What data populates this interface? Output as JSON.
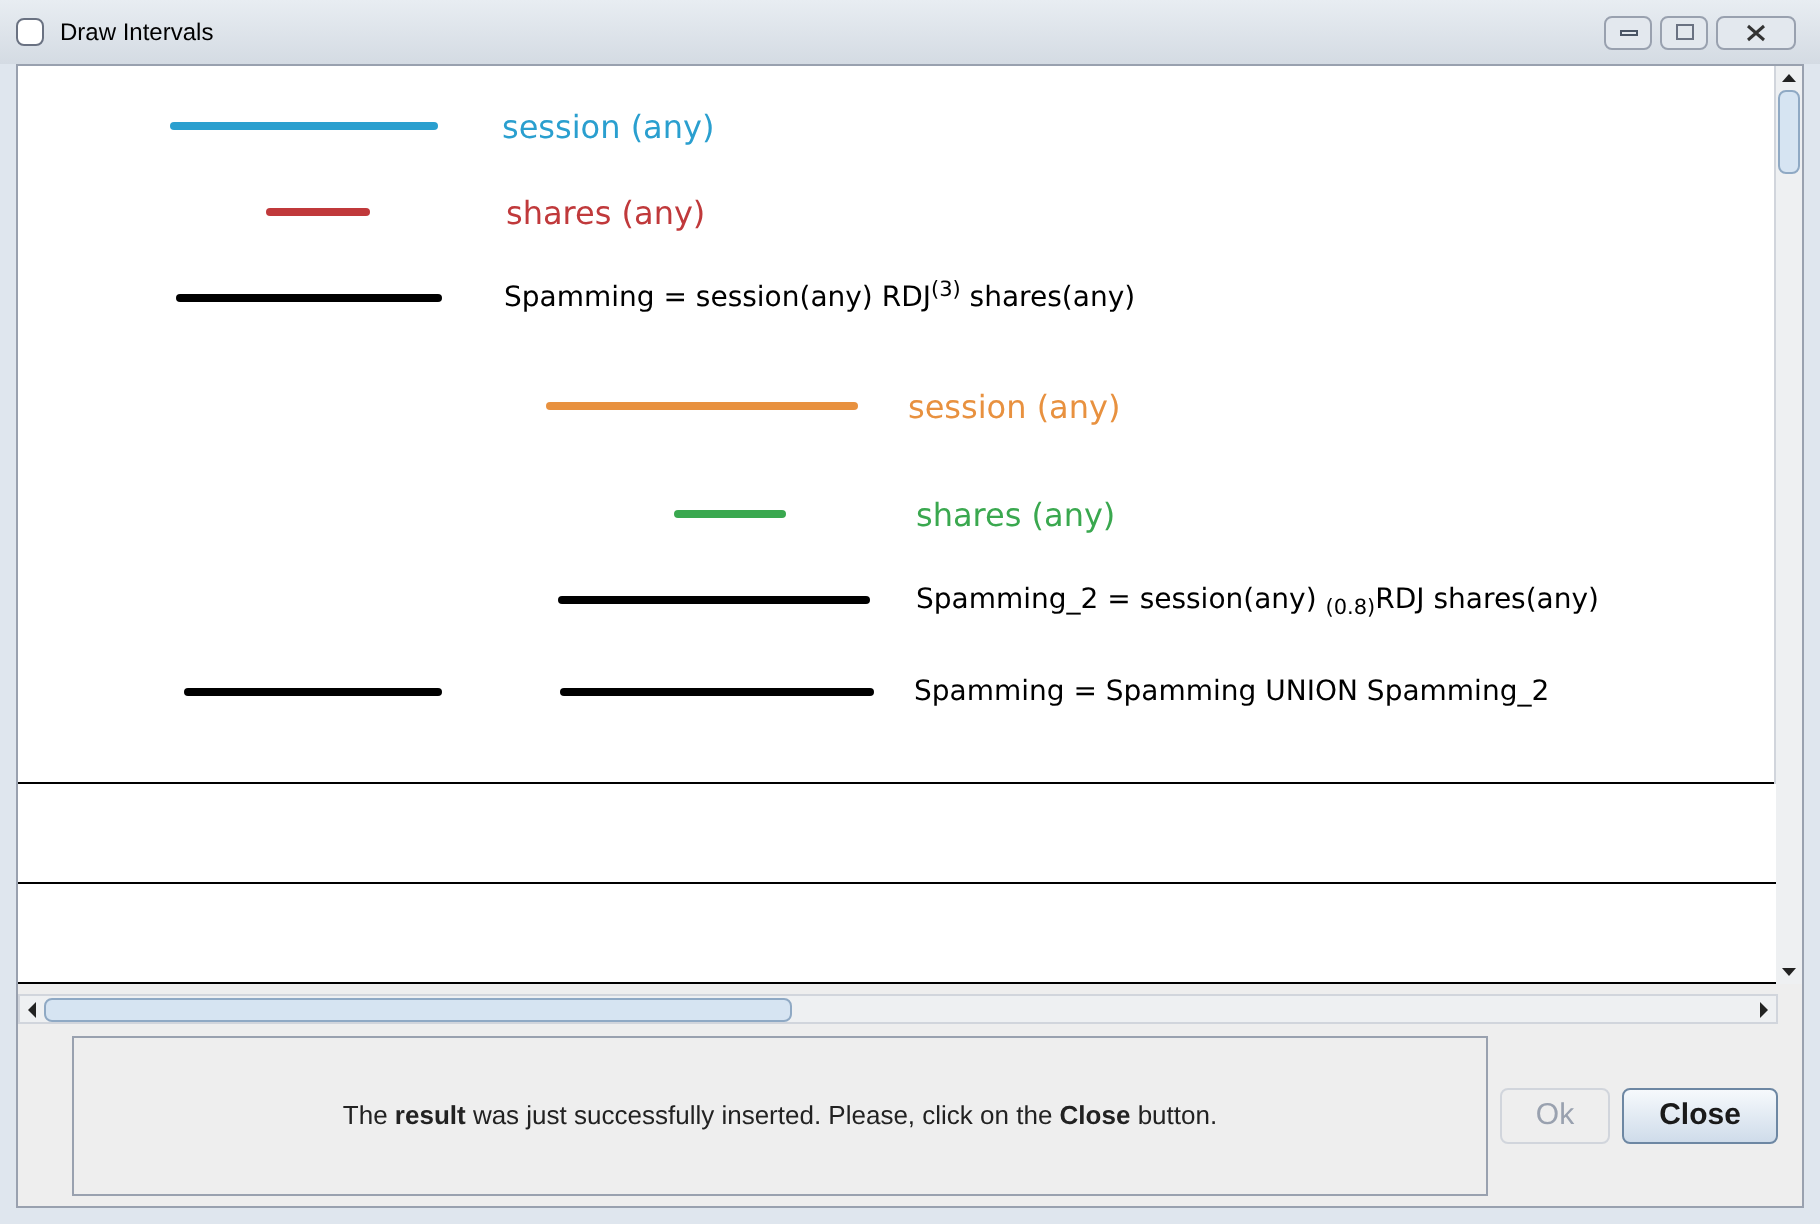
{
  "window": {
    "title": "Draw Intervals"
  },
  "intervals": [
    {
      "label": "session (any)",
      "color": "#2a9fcf",
      "kind": "operand"
    },
    {
      "label": "shares (any)",
      "color": "#c0393b",
      "kind": "operand"
    },
    {
      "label": "Spamming = session(any) RDJ$^{(3)}$ shares(any)",
      "color": "#000000",
      "kind": "result"
    },
    {
      "label": "session (any)",
      "color": "#e8913f",
      "kind": "operand"
    },
    {
      "label": "shares (any)",
      "color": "#3aa84f",
      "kind": "operand"
    },
    {
      "label": "Spamming_2 = session(any) $_{(0.8)}$RDJ shares(any)",
      "color": "#000000",
      "kind": "result"
    },
    {
      "label": "Spamming = Spamming UNION Spamming_2",
      "color": "#000000",
      "kind": "result"
    }
  ],
  "message": "The **result** was just successfully inserted. Please, click on the **Close** button.",
  "buttons": [
    {
      "label": "Ok",
      "disabled": true
    },
    {
      "label": "Close",
      "disabled": false
    }
  ]
}
